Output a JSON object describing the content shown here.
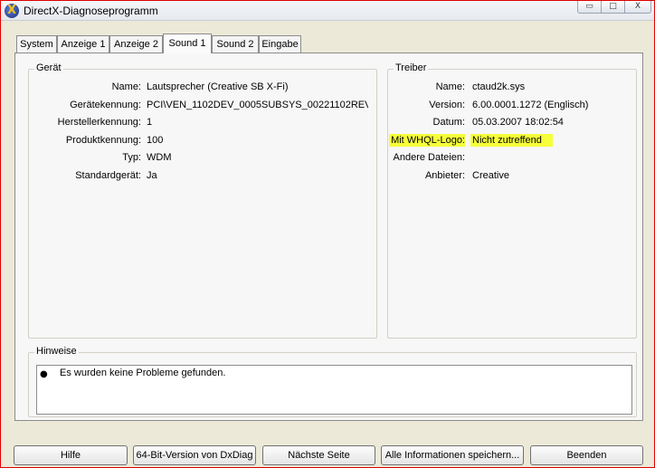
{
  "window": {
    "title": "DirectX-Diagnoseprogramm",
    "minimize": "▭",
    "maximize": "□",
    "close": "X"
  },
  "tabs": [
    {
      "label": "System"
    },
    {
      "label": "Anzeige 1"
    },
    {
      "label": "Anzeige 2"
    },
    {
      "label": "Sound 1",
      "active": true
    },
    {
      "label": "Sound 2"
    },
    {
      "label": "Eingabe"
    }
  ],
  "device": {
    "title": "Gerät",
    "rows": [
      {
        "label": "Name:",
        "value": "Lautsprecher (Creative SB X-Fi)"
      },
      {
        "label": "Gerätekennung:",
        "value": "PCI\\VEN_1102DEV_0005SUBSYS_00221102REV_0("
      },
      {
        "label": "Herstellerkennung:",
        "value": "1"
      },
      {
        "label": "Produktkennung:",
        "value": "100"
      },
      {
        "label": "Typ:",
        "value": "WDM"
      },
      {
        "label": "Standardgerät:",
        "value": "Ja"
      }
    ]
  },
  "driver": {
    "title": "Treiber",
    "rows": [
      {
        "label": "Name:",
        "value": "ctaud2k.sys"
      },
      {
        "label": "Version:",
        "value": "6.00.0001.1272 (Englisch)"
      },
      {
        "label": "Datum:",
        "value": "05.03.2007 18:02:54"
      },
      {
        "label": "Mit WHQL-Logo:",
        "value": "Nicht zutreffend"
      },
      {
        "label": "Andere Dateien:",
        "value": ""
      },
      {
        "label": "Anbieter:",
        "value": "Creative"
      }
    ],
    "highlight_color": "#f6ff3a"
  },
  "notes": {
    "title": "Hinweise",
    "items": [
      "Es wurden keine Probleme gefunden."
    ]
  },
  "buttons": {
    "help": "Hilfe",
    "x64": "64-Bit-Version von DxDiag",
    "next": "Nächste Seite",
    "save_all": "Alle Informationen speichern...",
    "exit": "Beenden"
  },
  "colors": {
    "window_border": "#e00000",
    "window_bg": "#ece9d8",
    "panel_bg": "#f7f7f7"
  }
}
